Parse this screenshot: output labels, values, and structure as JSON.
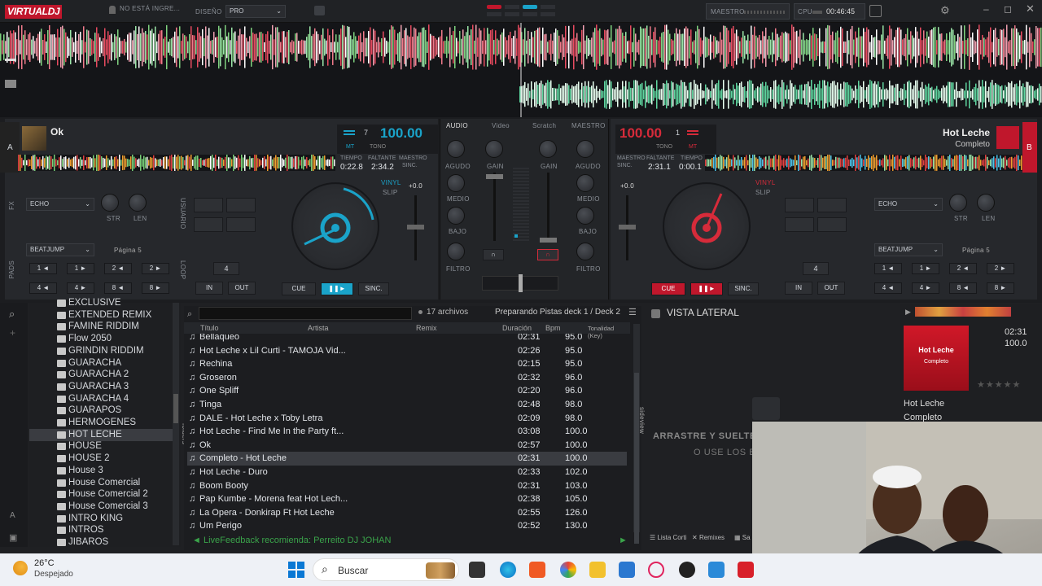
{
  "app": {
    "logo_left": "VIRTUAL",
    "logo_right": "DJ",
    "login": "NO ESTÁ INGRE...",
    "design_label": "DISEÑO",
    "design_value": "PRO",
    "master_label": "MAESTRO",
    "cpu_label": "CPU",
    "clock": "00:46:45"
  },
  "deckA": {
    "letter": "A",
    "title": "Ok",
    "key_num": "7",
    "bpm": "100.00",
    "mt": "MT",
    "tono": "TONO",
    "tiempo_label": "TIEMPO",
    "faltante_label": "FALTANTE",
    "maestro_label": "MAESTRO",
    "sinc_label": "SINC.",
    "tiempo": "0:22.8",
    "faltante": "2:34.2",
    "fx_effect": "ECHO",
    "str": "STR",
    "len": "LEN",
    "pads_mode": "BEATJUMP",
    "page": "Página 5",
    "pads": [
      "1 ◄",
      "1 ►",
      "2 ◄",
      "2 ►",
      "4 ◄",
      "4 ►",
      "8 ◄",
      "8 ►"
    ],
    "loop_size": "4",
    "in": "IN",
    "out": "OUT",
    "cue": "CUE",
    "play": "❚❚►",
    "sync": "SINC.",
    "vinyl": "VINYL",
    "slip": "SLIP",
    "pitch": "+0.0",
    "side_fx": "FX",
    "side_pads": "PADS",
    "side_usuario": "USUARIO",
    "side_loop": "LOOP"
  },
  "deckB": {
    "letter": "B",
    "title": "Hot Leche",
    "subtitle": "Completo",
    "key_num": "1",
    "bpm": "100.00",
    "mt": "MT",
    "tono": "TONO",
    "tiempo_label": "TIEMPO",
    "faltante_label": "FALTANTE",
    "maestro_label": "MAESTRO",
    "sinc_label": "SINC.",
    "tiempo": "0:00.1",
    "faltante": "2:31.1",
    "fx_effect": "ECHO",
    "str": "STR",
    "len": "LEN",
    "pads_mode": "BEATJUMP",
    "page": "Página 5",
    "pads": [
      "1 ◄",
      "1 ►",
      "2 ◄",
      "2 ►",
      "4 ◄",
      "4 ►",
      "8 ◄",
      "8 ►"
    ],
    "loop_size": "4",
    "in": "IN",
    "out": "OUT",
    "cue": "CUE",
    "play": "❚❚►",
    "sync": "SINC.",
    "vinyl": "VINYL",
    "slip": "SLIP",
    "pitch": "+0.0"
  },
  "mixer": {
    "tabs": [
      "AUDIO",
      "Video",
      "Scratch",
      "MAESTRO"
    ],
    "gain": "GAIN",
    "agudo": "AGUDO",
    "medio": "MEDIO",
    "bajo": "BAJO",
    "filtro": "FILTRO"
  },
  "folders": {
    "items": [
      "EXCLUSIVE",
      "EXTENDED REMIX",
      "FAMINE RIDDIM",
      "Flow 2050",
      "GRINDIN RIDDIM",
      "GUARACHA",
      "GUARACHA 2",
      "GUARACHA 3",
      "GUARACHA 4",
      "GUARAPOS",
      "HERMOGENES",
      "HOT LECHE",
      "HOUSE",
      "HOUSE 2",
      "House 3",
      "House Comercial",
      "House Comercial 2",
      "House Comercial 3",
      "INTRO KING",
      "INTROS",
      "JIBAROS"
    ],
    "selected": "HOT LECHE",
    "side_label": "folders"
  },
  "tracklist": {
    "count": "17 archivos",
    "status": "Preparando Pistas deck 1 / Deck 2",
    "columns": {
      "title": "Título",
      "artist": "Artista",
      "remix": "Remix",
      "duration": "Duración",
      "bpm": "Bpm",
      "key": "Tonalidad (Key)"
    },
    "rows": [
      {
        "title": "Bellaqueo",
        "dur": "02:31",
        "bpm": "95.0"
      },
      {
        "title": "Hot Leche x Lil Curti - TAMOJA Vid...",
        "dur": "02:26",
        "bpm": "95.0"
      },
      {
        "title": "Rechina",
        "dur": "02:15",
        "bpm": "95.0"
      },
      {
        "title": "Groseron",
        "dur": "02:32",
        "bpm": "96.0"
      },
      {
        "title": "One Spliff",
        "dur": "02:20",
        "bpm": "96.0"
      },
      {
        "title": "Tinga",
        "dur": "02:48",
        "bpm": "98.0"
      },
      {
        "title": "DALE - Hot Leche x Toby Letra",
        "dur": "02:09",
        "bpm": "98.0"
      },
      {
        "title": "Hot Leche - Find Me In the Party ft...",
        "dur": "03:08",
        "bpm": "100.0"
      },
      {
        "title": "Ok",
        "dur": "02:57",
        "bpm": "100.0"
      },
      {
        "title": "Completo - Hot Leche",
        "dur": "02:31",
        "bpm": "100.0"
      },
      {
        "title": "Hot Leche - Duro",
        "dur": "02:33",
        "bpm": "102.0"
      },
      {
        "title": "Boom Booty",
        "dur": "02:31",
        "bpm": "103.0"
      },
      {
        "title": "Pap Kumbe - Morena feat Hot Lech...",
        "dur": "02:38",
        "bpm": "105.0"
      },
      {
        "title": "La Opera - Donkirap Ft Hot Leche",
        "dur": "02:55",
        "bpm": "126.0"
      },
      {
        "title": "Um Perigo",
        "dur": "02:52",
        "bpm": "130.0"
      }
    ],
    "livefeedback": "LiveFeedback recomienda: Perreito DJ JOHAN",
    "side_label": "sideview"
  },
  "sideview": {
    "title": "VISTA LATERAL",
    "drop_line1": "ARRASTRE Y SUELTE",
    "drop_line2": "O USE LOS B",
    "tabs": [
      "Lista Corti",
      "Remixes",
      "Sa"
    ]
  },
  "info": {
    "cover_title": "Hot Leche",
    "cover_sub": "Completo",
    "time": "02:31",
    "bpm": "100.0",
    "title": "Hot Leche",
    "subtitle": "Completo"
  },
  "taskbar": {
    "temp": "26°C",
    "weather": "Despejado",
    "search": "Buscar"
  },
  "colors": {
    "accentA": "#1aa3c9",
    "accentB": "#d62b3a"
  }
}
